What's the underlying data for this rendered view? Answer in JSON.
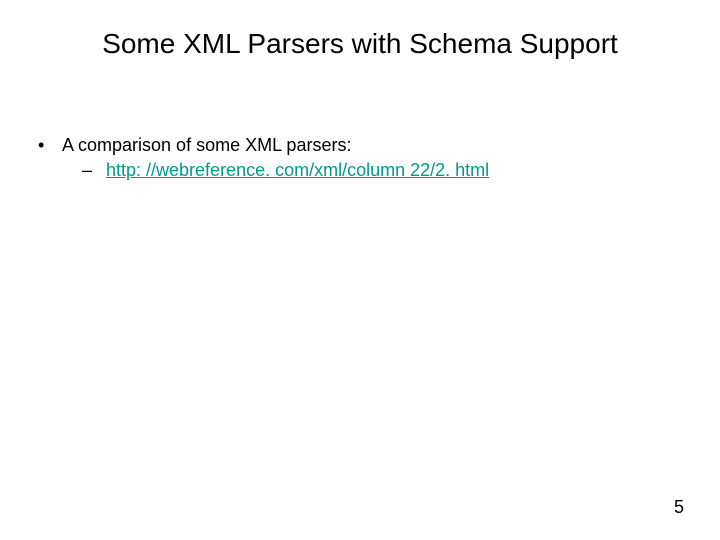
{
  "title": "Some XML Parsers with Schema Support",
  "bullets": {
    "l1_text": "A comparison of some XML parsers:",
    "l2_link_text": "http: //webreference. com/xml/column 22/2. html"
  },
  "markers": {
    "l1": "•",
    "l2": "–"
  },
  "page_number": "5"
}
